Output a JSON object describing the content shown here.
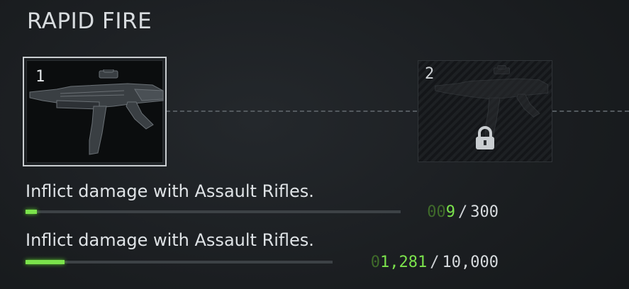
{
  "header": {
    "title": "RAPID FIRE"
  },
  "tiers": [
    {
      "number": "1",
      "weapon_icon": "assault-rifle-icon",
      "locked": false
    },
    {
      "number": "2",
      "weapon_icon": "assault-rifle-icon",
      "locked": true,
      "lock_icon": "padlock-icon"
    }
  ],
  "challenges": [
    {
      "text": "Inflict damage with Assault Rifles.",
      "progress_lead": "00",
      "progress_value": "9",
      "separator": "/",
      "target": "300",
      "progress_fraction": 0.03
    },
    {
      "text": "Inflict damage with Assault Rifles.",
      "progress_lead": "0",
      "progress_value": "1,281",
      "separator": "/",
      "target": "10,000",
      "progress_fraction": 0.128
    }
  ],
  "colors": {
    "accent": "#7be34c",
    "accent_dim": "#3f6b2a",
    "text": "#dfe3e6"
  }
}
